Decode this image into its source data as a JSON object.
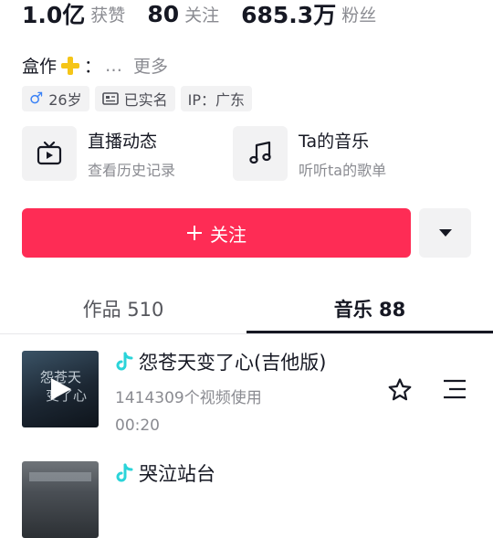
{
  "stats": [
    {
      "value": "1.0亿",
      "label": "获赞"
    },
    {
      "value": "80",
      "label": "关注"
    },
    {
      "value": "685.3万",
      "label": "粉丝"
    }
  ],
  "bio": {
    "text": "盒作",
    "suffix": "：",
    "ellipsis": "…",
    "more": "更多"
  },
  "tags": {
    "age": "26岁",
    "verified": "已实名",
    "ip": "IP：广东"
  },
  "cards": [
    {
      "title": "直播动态",
      "sub": "查看历史记录",
      "icon": "tv-icon"
    },
    {
      "title": "Ta的音乐",
      "sub": "听听ta的歌单",
      "icon": "music-note-icon"
    }
  ],
  "follow": {
    "label": "关注",
    "color": "#fe2c55"
  },
  "tabs": [
    {
      "label": "作品 510",
      "active": false
    },
    {
      "label": "音乐 88",
      "active": true
    }
  ],
  "music": [
    {
      "title": "怨苍天变了心(吉他版)",
      "uses": "1414309个视频使用",
      "duration": "00:20"
    },
    {
      "title": "哭泣站台"
    }
  ],
  "colors": {
    "accent": "#fe2c55",
    "music_icon": "#2bd4d9",
    "muted": "#8a8b91"
  }
}
